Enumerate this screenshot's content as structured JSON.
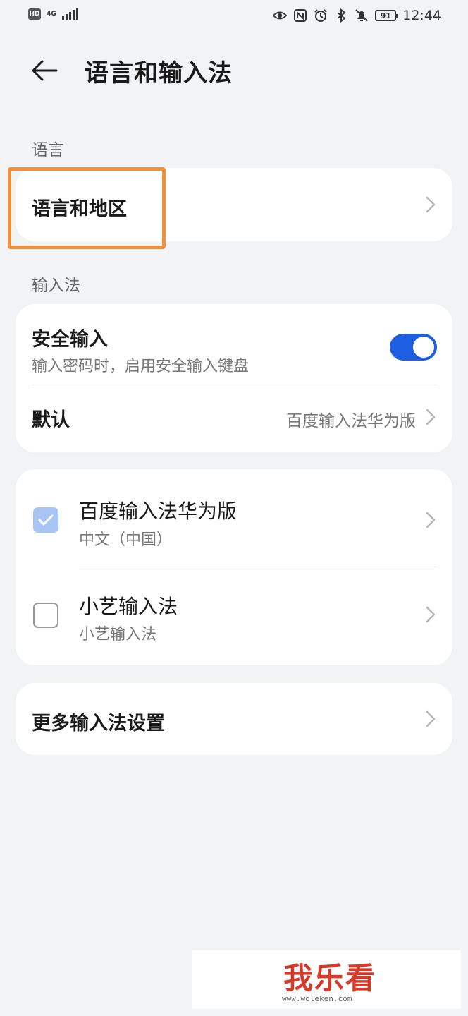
{
  "status_bar": {
    "hd": "HD",
    "network": "4G",
    "battery": "91",
    "time": "12:44"
  },
  "header": {
    "title": "语言和输入法"
  },
  "language_section": {
    "label": "语言",
    "language_region": "语言和地区"
  },
  "input_section": {
    "label": "输入法",
    "secure_input": {
      "title": "安全输入",
      "subtitle": "输入密码时，启用安全输入键盘",
      "enabled": true
    },
    "default": {
      "title": "默认",
      "value": "百度输入法华为版"
    }
  },
  "input_methods": [
    {
      "name": "百度输入法华为版",
      "language": "中文（中国）",
      "checked": true
    },
    {
      "name": "小艺输入法",
      "language": "小艺输入法",
      "checked": false
    }
  ],
  "more_settings": "更多输入法设置",
  "watermark": {
    "text": "我乐看",
    "url": "www.woleken.com"
  },
  "colors": {
    "accent": "#1d5fe0",
    "highlight": "#f3913a",
    "background": "#f1f3f5"
  }
}
